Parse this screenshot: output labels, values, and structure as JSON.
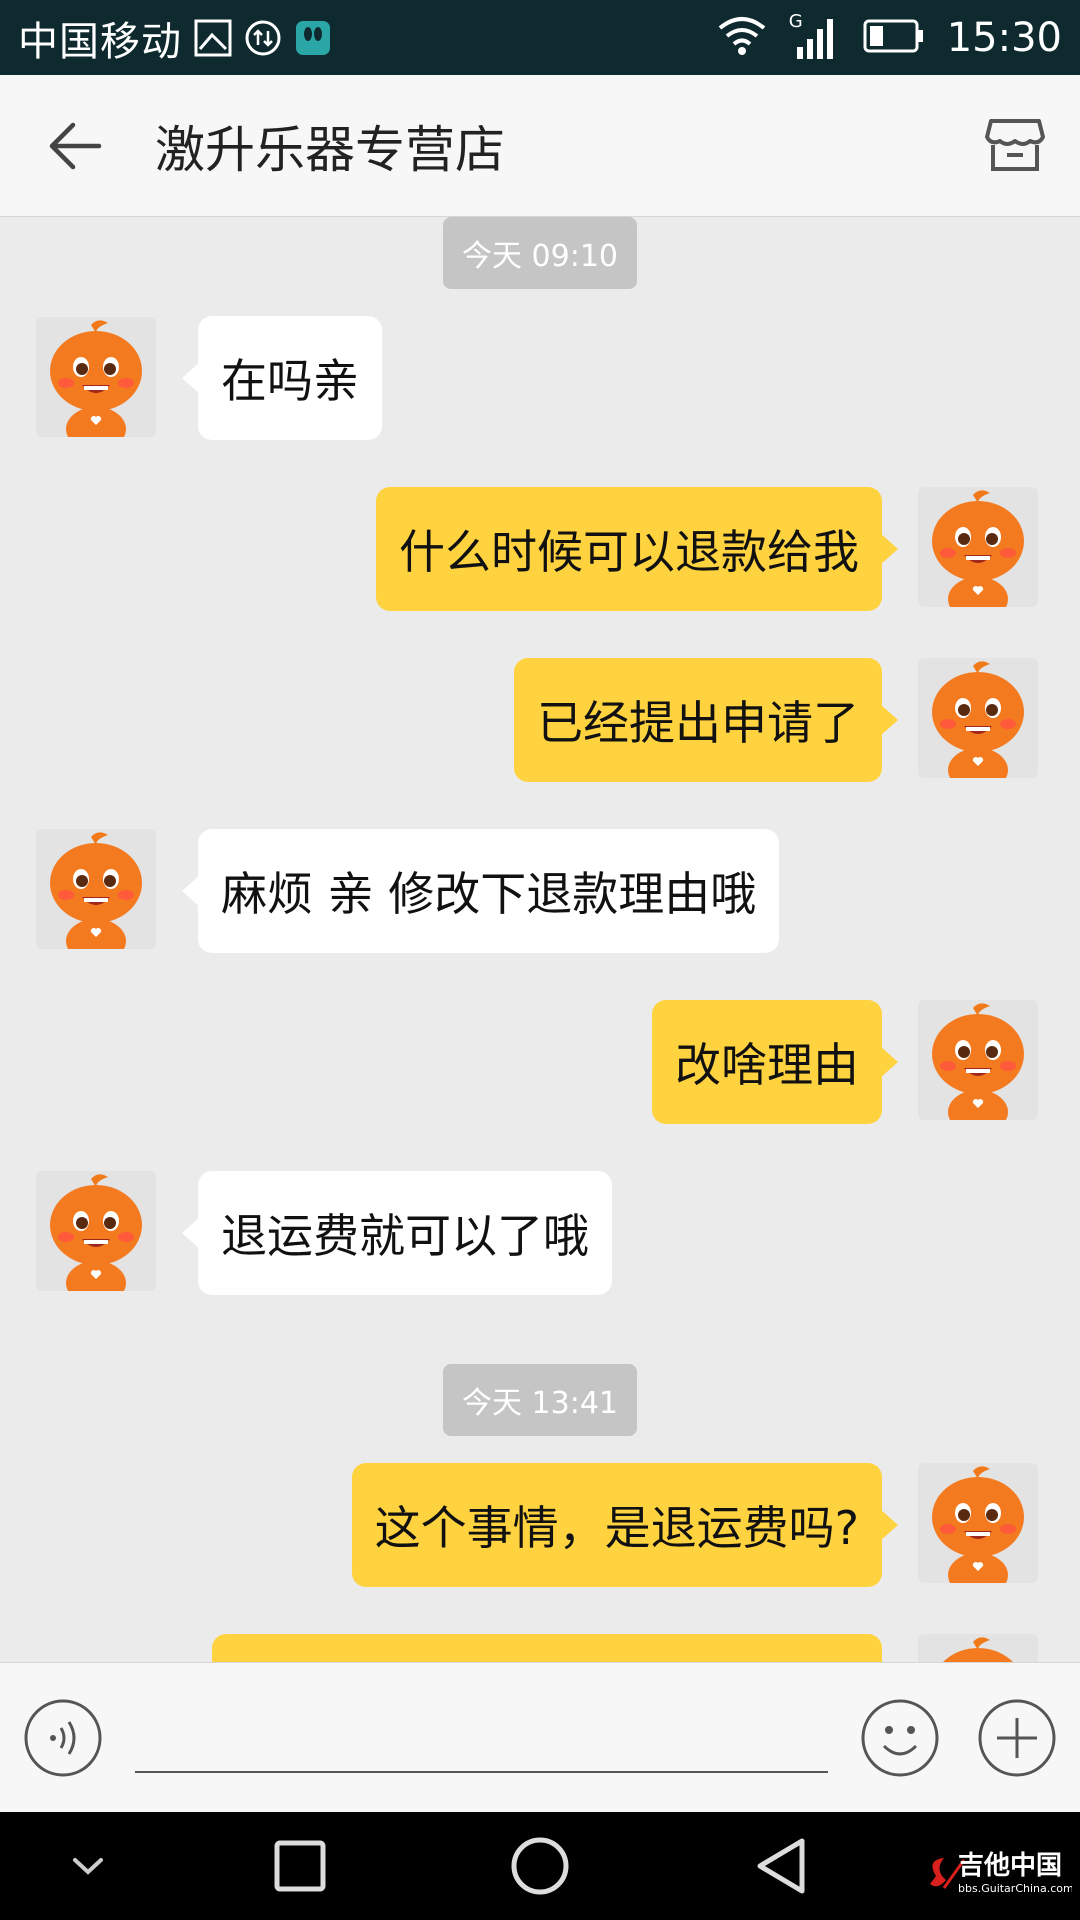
{
  "status_bar": {
    "carrier": "中国移动",
    "network_label": "G",
    "time": "15:30"
  },
  "header": {
    "title": "激升乐器专营店"
  },
  "chat": {
    "timestamps": [
      "今天 09:10",
      "今天 13:41"
    ],
    "messages": [
      {
        "direction": "in",
        "text": "在吗亲"
      },
      {
        "direction": "out",
        "text": "什么时候可以退款给我"
      },
      {
        "direction": "out",
        "text": "已经提出申请了"
      },
      {
        "direction": "in",
        "text": "麻烦 亲 修改下退款理由哦"
      },
      {
        "direction": "out",
        "text": "改啥理由"
      },
      {
        "direction": "in",
        "text": "退运费就可以了哦"
      },
      {
        "direction": "out",
        "text": "这个事情，是退运费吗?"
      },
      {
        "direction": "out",
        "text": ""
      }
    ]
  },
  "input_bar": {
    "value": "",
    "placeholder": ""
  },
  "watermark": {
    "name": "吉他中国",
    "site": "bbs.GuitarChina.com"
  },
  "colors": {
    "outgoing_bubble": "#ffd23f",
    "incoming_bubble": "#ffffff",
    "chat_background": "#ebebeb",
    "timestamp_bg": "#c5c5c5",
    "status_bar": "#0e2a2e"
  }
}
